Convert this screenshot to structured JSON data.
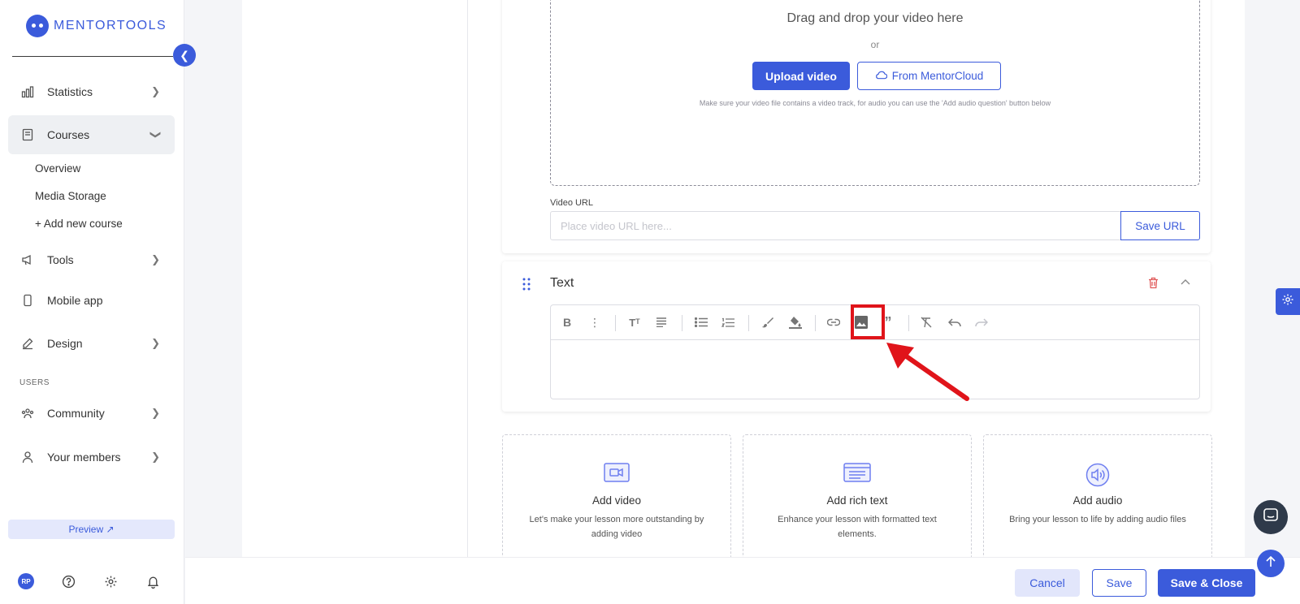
{
  "brand": {
    "name": "MENTORTOOLS",
    "accent": "#3b5bdb"
  },
  "sidebar": {
    "items": [
      {
        "label": "Statistics"
      },
      {
        "label": "Courses"
      },
      {
        "label": "Tools"
      },
      {
        "label": "Mobile app"
      },
      {
        "label": "Design"
      },
      {
        "label": "Community"
      },
      {
        "label": "Your members"
      }
    ],
    "course_subitems": [
      "Overview",
      "Media Storage",
      "+ Add new course"
    ],
    "section_users": "USERS",
    "preview_label": "Preview ↗",
    "avatar_initials": "RP"
  },
  "video_block": {
    "drop_title": "Drag and drop your video here",
    "or_text": "or",
    "upload_label": "Upload video",
    "cloud_label": "From MentorCloud",
    "hint": "Make sure your video file contains a video track, for audio you can use the 'Add audio question' button below",
    "url_label": "Video URL",
    "url_placeholder": "Place video URL here...",
    "save_url_label": "Save URL"
  },
  "text_block": {
    "title": "Text"
  },
  "add_blocks": [
    {
      "title": "Add video",
      "desc": "Let's make your lesson more outstanding by adding video",
      "icon": "video-icon"
    },
    {
      "title": "Add rich text",
      "desc": "Enhance your lesson with formatted text elements.",
      "icon": "rich-text-icon"
    },
    {
      "title": "Add audio",
      "desc": "Bring your lesson to life by adding audio files",
      "icon": "audio-icon"
    }
  ],
  "footer": {
    "cancel_label": "Cancel",
    "save_label": "Save",
    "save_close_label": "Save & Close"
  },
  "colors": {
    "highlight": "#e0141a",
    "danger": "#e05a5a"
  }
}
